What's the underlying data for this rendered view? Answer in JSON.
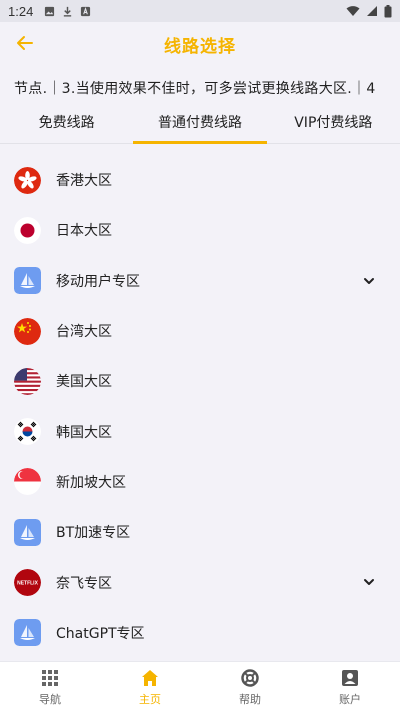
{
  "status_bar": {
    "time": "1:24"
  },
  "header": {
    "title": "线路选择"
  },
  "notice": {
    "text": "节点.｜3.当使用效果不佳时，可多尝试更换线路大区.｜4"
  },
  "tabs": [
    {
      "label": "免费线路",
      "active": false
    },
    {
      "label": "普通付费线路",
      "active": true
    },
    {
      "label": "VIP付费线路",
      "active": false
    }
  ],
  "regions": [
    {
      "label": "香港大区",
      "icon": "hong-kong-flag-icon",
      "expandable": false
    },
    {
      "label": "日本大区",
      "icon": "japan-flag-icon",
      "expandable": false
    },
    {
      "label": "移动用户专区",
      "icon": "app-logo-icon",
      "expandable": true
    },
    {
      "label": "台湾大区",
      "icon": "china-flag-icon",
      "expandable": false
    },
    {
      "label": "美国大区",
      "icon": "us-flag-icon",
      "expandable": false
    },
    {
      "label": "韩国大区",
      "icon": "korea-flag-icon",
      "expandable": false
    },
    {
      "label": "新加坡大区",
      "icon": "singapore-flag-icon",
      "expandable": false
    },
    {
      "label": "BT加速专区",
      "icon": "app-logo-icon",
      "expandable": false
    },
    {
      "label": "奈飞专区",
      "icon": "netflix-logo-icon",
      "expandable": true,
      "logo_text": "NETFLIX"
    },
    {
      "label": "ChatGPT专区",
      "icon": "app-logo-icon",
      "expandable": false
    }
  ],
  "bottom_nav": [
    {
      "label": "导航",
      "icon": "grid-icon",
      "active": false
    },
    {
      "label": "主页",
      "icon": "home-icon",
      "active": true
    },
    {
      "label": "帮助",
      "icon": "lifebuoy-icon",
      "active": false
    },
    {
      "label": "账户",
      "icon": "account-icon",
      "active": false
    }
  ],
  "colors": {
    "accent": "#f5b400",
    "background": "#f3f2f8"
  }
}
